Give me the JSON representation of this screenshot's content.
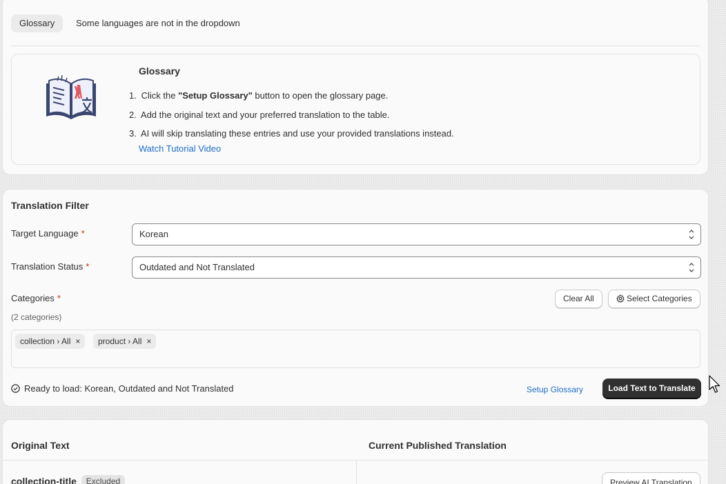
{
  "glossary_card": {
    "tab_label": "Glossary",
    "tab_note": "Some languages are not in the dropdown",
    "illustration_icon": "open-book-translate-icon",
    "title": "Glossary",
    "steps": [
      {
        "num": "1.",
        "pre": "Click the ",
        "bold": "\"Setup Glossary\"",
        "post": " button to open the glossary page."
      },
      {
        "num": "2.",
        "text": "Add the original text and your preferred translation to the table."
      },
      {
        "num": "3.",
        "text": "AI will skip translating these entries and use your provided translations instead."
      }
    ],
    "tutorial_link": "Watch Tutorial Video"
  },
  "filter": {
    "title": "Translation Filter",
    "required_mark": "*",
    "target_language": {
      "label": "Target Language",
      "value": "Korean"
    },
    "translation_status": {
      "label": "Translation Status",
      "value": "Outdated and Not Translated"
    },
    "categories": {
      "label": "Categories",
      "count_text": "(2 categories)",
      "clear_all": "Clear All",
      "select_categories": "Select Categories",
      "tags": [
        {
          "label": "collection › All",
          "remove": "×"
        },
        {
          "label": "product › All",
          "remove": "×"
        }
      ]
    },
    "status_text": "Ready to load: Korean, Outdated and Not Translated",
    "setup_glossary": "Setup Glossary",
    "load_button": "Load Text to Translate"
  },
  "table": {
    "headers": [
      "Original Text",
      "Current Published Translation"
    ],
    "rows": [
      {
        "key": "collection-title",
        "badge": "Excluded",
        "action": "Preview AI Translation"
      }
    ]
  },
  "colors": {
    "link": "#1f6fc6",
    "required": "#d72c0d",
    "primary_button": "#303030"
  }
}
